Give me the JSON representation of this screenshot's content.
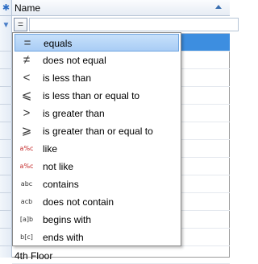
{
  "header": {
    "column_label": "Name"
  },
  "filter": {
    "current_operator_symbol": "="
  },
  "menu": {
    "items": [
      {
        "symbol": "=",
        "label": "equals"
      },
      {
        "symbol": "≠",
        "label": "does not equal"
      },
      {
        "symbol": "<",
        "label": "is less than"
      },
      {
        "symbol": "⩽",
        "label": "is less than or equal to"
      },
      {
        "symbol": ">",
        "label": "is greater than"
      },
      {
        "symbol": "⩾",
        "label": "is greater than or equal to"
      },
      {
        "symbol": "a%c",
        "label": "like"
      },
      {
        "symbol": "a%c",
        "label": "not like"
      },
      {
        "symbol": "abc",
        "label": "contains"
      },
      {
        "symbol": "acb",
        "label": "does not contain"
      },
      {
        "symbol": "[a]b",
        "label": "begins with"
      },
      {
        "symbol": "b[c]",
        "label": "ends with"
      }
    ],
    "selected_index": 0
  },
  "rows": {
    "visible_last_row": "4th Floor"
  },
  "colors": {
    "selection": "#3d8ee0",
    "accent": "#2b6cc4"
  }
}
